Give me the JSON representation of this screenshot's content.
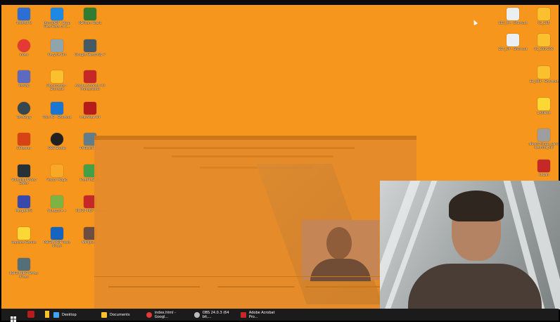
{
  "desktop_icons_left": [
    {
      "label": "TextPad 8",
      "icon": "textpad-icon",
      "color": "#2b6fd6"
    },
    {
      "label": "PrimoPDF - Drop\nFiles Here to C...",
      "icon": "primopdf-icon",
      "color": "#1e88e5"
    },
    {
      "label": "PDFsam Basic",
      "icon": "pdfsam-icon",
      "color": "#2e7d32"
    },
    {
      "label": "index",
      "icon": "chrome-icon",
      "color": "#e53935"
    },
    {
      "label": "Recycle Bin",
      "icon": "recycle-bin-icon",
      "color": "#90a4ae"
    },
    {
      "label": "Google SketchUp 7",
      "icon": "sketchup-icon",
      "color": "#455a64"
    },
    {
      "label": "TeeTap",
      "icon": "teetap-icon",
      "color": "#5c6bc0"
    },
    {
      "label": "Documents -\nShortcut",
      "icon": "documents-icon",
      "color": "#fbc02d"
    },
    {
      "label": "Adobe Acrobat 7.0\nProfessional",
      "icon": "acrobat-icon",
      "color": "#c62828"
    },
    {
      "label": "TeraCopy",
      "icon": "teracopy-icon",
      "color": "#37474f"
    },
    {
      "label": "This PC - Shortcut",
      "icon": "this-pc-icon",
      "color": "#1976d2"
    },
    {
      "label": "IrfanView 64",
      "icon": "irfanview-icon",
      "color": "#b71c1c"
    },
    {
      "label": "CCleaner",
      "icon": "ccleaner-icon",
      "color": "#d84315"
    },
    {
      "label": "OBS Studio",
      "icon": "obs-studio-icon",
      "color": "#212121"
    },
    {
      "label": "TXToolsHiker",
      "icon": "txtools-icon",
      "color": "#607d8b"
    },
    {
      "label": "VideoPad Video\nEditor",
      "icon": "videopad-icon",
      "color": "#263238"
    },
    {
      "label": "Vector Magic",
      "icon": "vector-magic-icon",
      "color": "#f9a825"
    },
    {
      "label": "FreeFileSync",
      "icon": "freefilesync-icon",
      "color": "#43a047"
    },
    {
      "label": "MergeMP3",
      "icon": "mergemp3-icon",
      "color": "#3949ab"
    },
    {
      "label": "Notepad++",
      "icon": "notepadpp-icon",
      "color": "#7cb342"
    },
    {
      "label": "PDF24 PDF Editor",
      "icon": "pdf24-editor-icon",
      "color": "#c62828"
    },
    {
      "label": "Replace Genius",
      "icon": "replace-genius-icon",
      "color": "#fdd835"
    },
    {
      "label": "PDF24 PDF Tools\n(Free)",
      "icon": "pdf24-tools-icon",
      "color": "#1565c0"
    },
    {
      "label": "MP4Joiner",
      "icon": "mp4joiner-icon",
      "color": "#6d4c41"
    },
    {
      "label": "PDF24 PDF Writer\n(Free)",
      "icon": "pdf24-writer-icon",
      "color": "#546e7a"
    }
  ],
  "desktop_icons_right": [
    {
      "label": "SET_PA - Shortcut",
      "icon": "file-shortcut-icon",
      "color": "#eceff1"
    },
    {
      "label": "01_105",
      "icon": "folder-icon",
      "color": "#fbc02d"
    },
    {
      "label": "SET_UP - Shortcut",
      "icon": "file-shortcut-icon",
      "color": "#eceff1"
    },
    {
      "label": "01_105-200",
      "icon": "folder-icon",
      "color": "#fbc02d"
    },
    {
      "label": "32_003 - Shortcut",
      "icon": "folder-shortcut-icon",
      "color": "#fbc02d"
    },
    {
      "label": "LARNAX",
      "icon": "document-icon",
      "color": "#fdd835"
    },
    {
      "label": "alberto-lingo_carta\nidentità_full",
      "icon": "image-file-icon",
      "color": "#9e9e9e"
    },
    {
      "label": "kabah",
      "icon": "pdf-file-icon",
      "color": "#c62828"
    }
  ],
  "taskbar": {
    "items": [
      {
        "label": "Desktop",
        "icon": "desktop-folder-icon",
        "color": "#42a5f5"
      },
      {
        "label": "Documents",
        "icon": "documents-folder-icon",
        "color": "#fbc02d"
      },
      {
        "label": "index.html - Googl...",
        "icon": "chrome-icon",
        "color": "#e53935"
      },
      {
        "label": "OBS 24.0.3 (64 bit,...",
        "icon": "obs-icon",
        "color": "#bdbdbd"
      },
      {
        "label": "Adobe Acrobat Pro...",
        "icon": "acrobat-icon",
        "color": "#c62828"
      }
    ]
  },
  "colors": {
    "desktop_bg": "#f7961d",
    "taskbar_bg": "#1b1b1b"
  }
}
